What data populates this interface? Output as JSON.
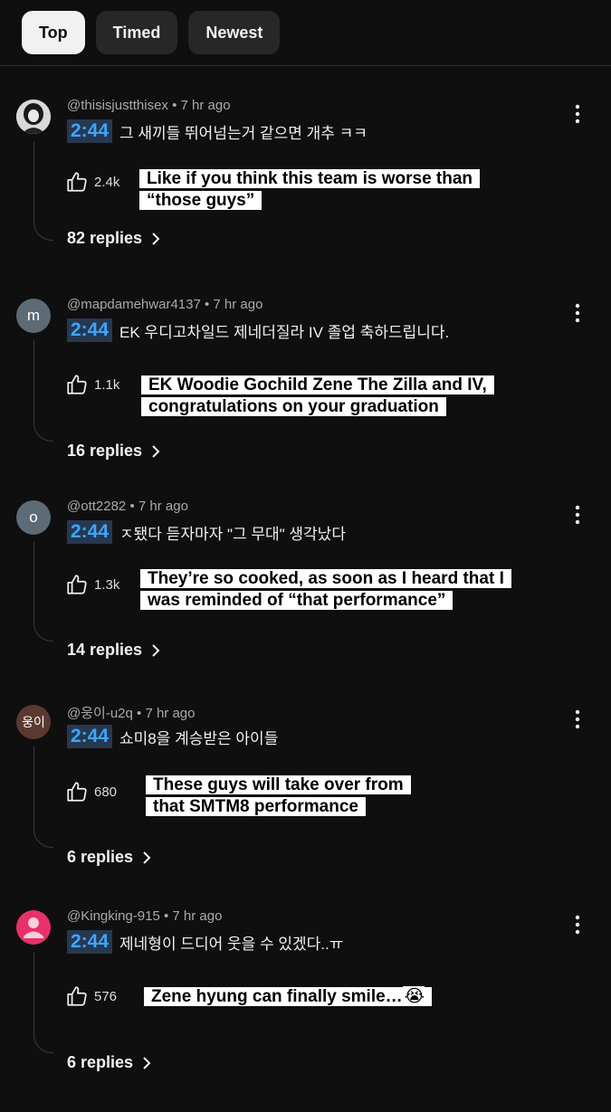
{
  "tabs": [
    {
      "label": "Top",
      "active": true
    },
    {
      "label": "Timed",
      "active": false
    },
    {
      "label": "Newest",
      "active": false
    }
  ],
  "comments": [
    {
      "author": "@thisisjustthisex",
      "age": "7 hr ago",
      "timestamp": "2:44",
      "text": "그 새끼들 뛰어넘는거 같으면 개추 ㅋㅋ",
      "likes": "2.4k",
      "translation": "Like if you think this team is worse than “those guys”",
      "replies": "82 replies",
      "avatar": {
        "type": "photo",
        "letter": "",
        "color": "#c9c9c9"
      }
    },
    {
      "author": "@mapdamehwar4137",
      "age": "7 hr ago",
      "timestamp": "2:44",
      "text": "EK 우디고차일드 제네더질라 IV 졸업 축하드립니다.",
      "likes": "1.1k",
      "translation": "EK Woodie Gochild Zene The Zilla and IV, congratulations on your graduation",
      "replies": "16 replies",
      "avatar": {
        "type": "letter",
        "letter": "m",
        "color": "#5c6b75"
      }
    },
    {
      "author": "@ott2282",
      "age": "7 hr ago",
      "timestamp": "2:44",
      "text": "ㅈ됐다 듣자마자 \"그 무대\" 생각났다",
      "likes": "1.3k",
      "translation": "They’re so cooked, as soon as I heard that I was reminded of “that performance”",
      "replies": "14 replies",
      "avatar": {
        "type": "letter",
        "letter": "o",
        "color": "#5c6b75"
      }
    },
    {
      "author": "@웅이-u2q",
      "age": "7 hr ago",
      "timestamp": "2:44",
      "text": "쇼미8을 계승받은 아이들",
      "likes": "680",
      "translation": "These guys will take over from that SMTM8 performance",
      "replies": "6 replies",
      "avatar": {
        "type": "letter",
        "letter": "웅이",
        "color": "#5a3a30"
      }
    },
    {
      "author": "@Kingking-915",
      "age": "7 hr ago",
      "timestamp": "2:44",
      "text": "제네형이 드디어 웃을 수 있겠다..ㅠ",
      "likes": "576",
      "translation": "Zene hyung can finally smile…",
      "translation_emoji": "😭",
      "replies": "6 replies",
      "avatar": {
        "type": "person",
        "letter": "",
        "color": "#e8316a"
      }
    }
  ]
}
